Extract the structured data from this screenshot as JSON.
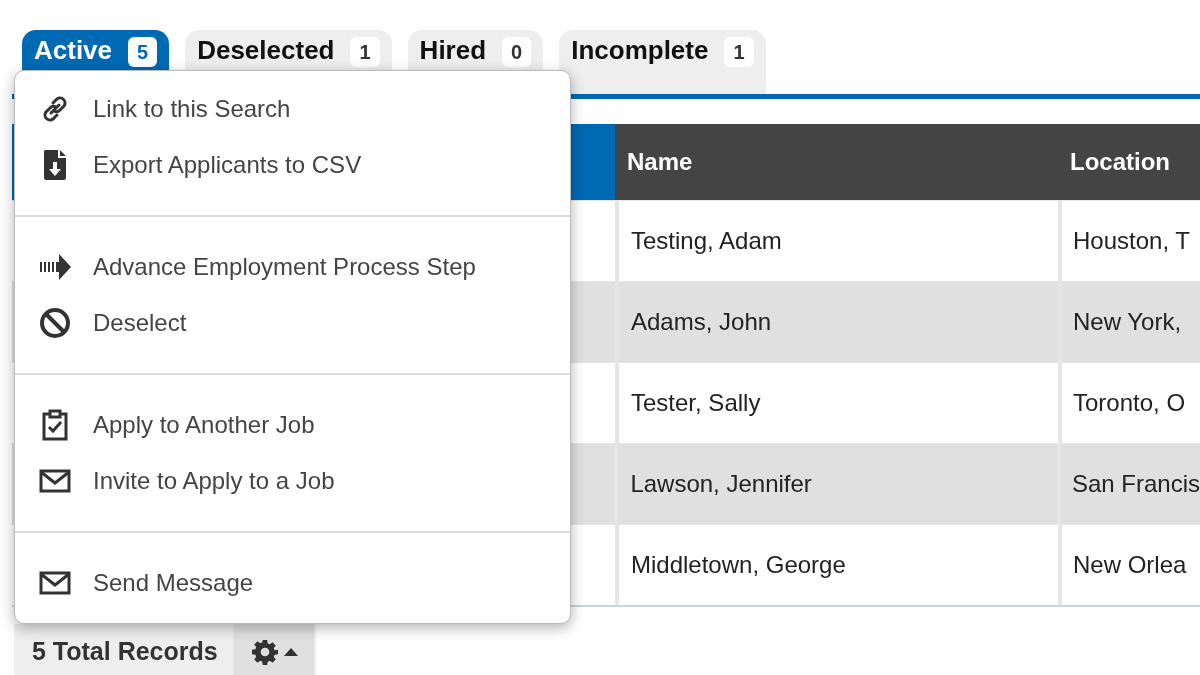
{
  "tabs": [
    {
      "label": "Active",
      "count": "5",
      "selected": true
    },
    {
      "label": "Deselected",
      "count": "1",
      "selected": false
    },
    {
      "label": "Hired",
      "count": "0",
      "selected": false
    },
    {
      "label": "Incomplete",
      "count": "1",
      "selected": false
    }
  ],
  "table": {
    "columns": [
      "Name",
      "Location"
    ],
    "rows": [
      {
        "name": "Testing, Adam",
        "location": "Houston, T"
      },
      {
        "name": "Adams, John",
        "location": "New York,"
      },
      {
        "name": "Tester, Sally",
        "location": "Toronto, O"
      },
      {
        "name": "Lawson, Jennifer",
        "location": "San Francis"
      },
      {
        "name": "Middletown, George",
        "location": "New Orlea"
      }
    ]
  },
  "menu": {
    "groups": [
      [
        {
          "label": "Link to this Search"
        },
        {
          "label": "Export Applicants to CSV"
        }
      ],
      [
        {
          "label": "Advance Employment Process Step"
        },
        {
          "label": "Deselect"
        }
      ],
      [
        {
          "label": "Apply to Another Job"
        },
        {
          "label": "Invite to Apply to a Job"
        }
      ],
      [
        {
          "label": "Send Message"
        }
      ]
    ]
  },
  "footer": {
    "total": "5 Total Records"
  }
}
